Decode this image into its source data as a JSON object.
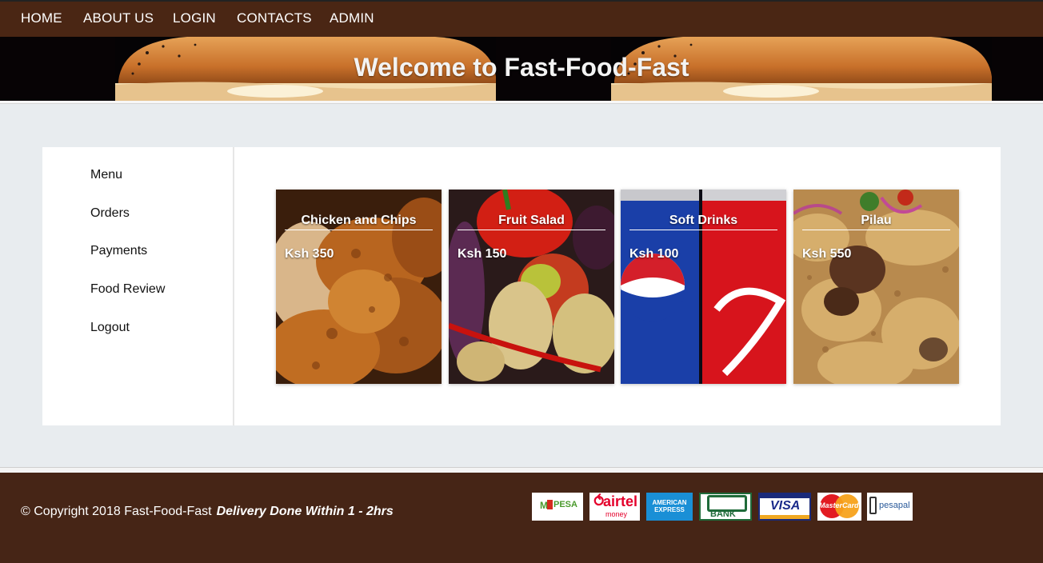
{
  "nav": {
    "items": [
      "HOME",
      "ABOUT US",
      "LOGIN",
      "CONTACTS",
      "ADMIN"
    ]
  },
  "banner": {
    "title": "Welcome to Fast-Food-Fast"
  },
  "sidebar": {
    "items": [
      "Menu",
      "Orders",
      "Payments",
      "Food Review",
      "Logout"
    ]
  },
  "menu": {
    "items": [
      {
        "name": "Chicken and Chips",
        "price": "Ksh 350",
        "image": "fried-chicken-image"
      },
      {
        "name": "Fruit Salad",
        "price": "Ksh 150",
        "image": "fruit-vegetables-image"
      },
      {
        "name": "Soft Drinks",
        "price": "Ksh 100",
        "image": "soda-cans-image"
      },
      {
        "name": "Pilau",
        "price": "Ksh 550",
        "image": "pilau-rice-image"
      }
    ]
  },
  "footer": {
    "copyright": "© Copyright 2018 Fast-Food-Fast",
    "delivery": "Delivery Done Within 1 - 2hrs",
    "payments": [
      {
        "label": "PESA",
        "prefix": "M",
        "name": "mpesa-logo"
      },
      {
        "label": "airtel",
        "sub": "money",
        "name": "airtel-money-logo"
      },
      {
        "label": "AMERICAN EXPRESS",
        "name": "american-express-logo"
      },
      {
        "label": "BANK",
        "name": "co-op-bank-logo"
      },
      {
        "label": "VISA",
        "name": "visa-logo"
      },
      {
        "label": "MasterCard",
        "name": "mastercard-logo"
      },
      {
        "label": "pesapal",
        "name": "pesapal-logo"
      }
    ]
  },
  "colors": {
    "nav_bg": "#4a2614",
    "footer_bg": "#462516",
    "page_bg": "#e8ecef"
  }
}
